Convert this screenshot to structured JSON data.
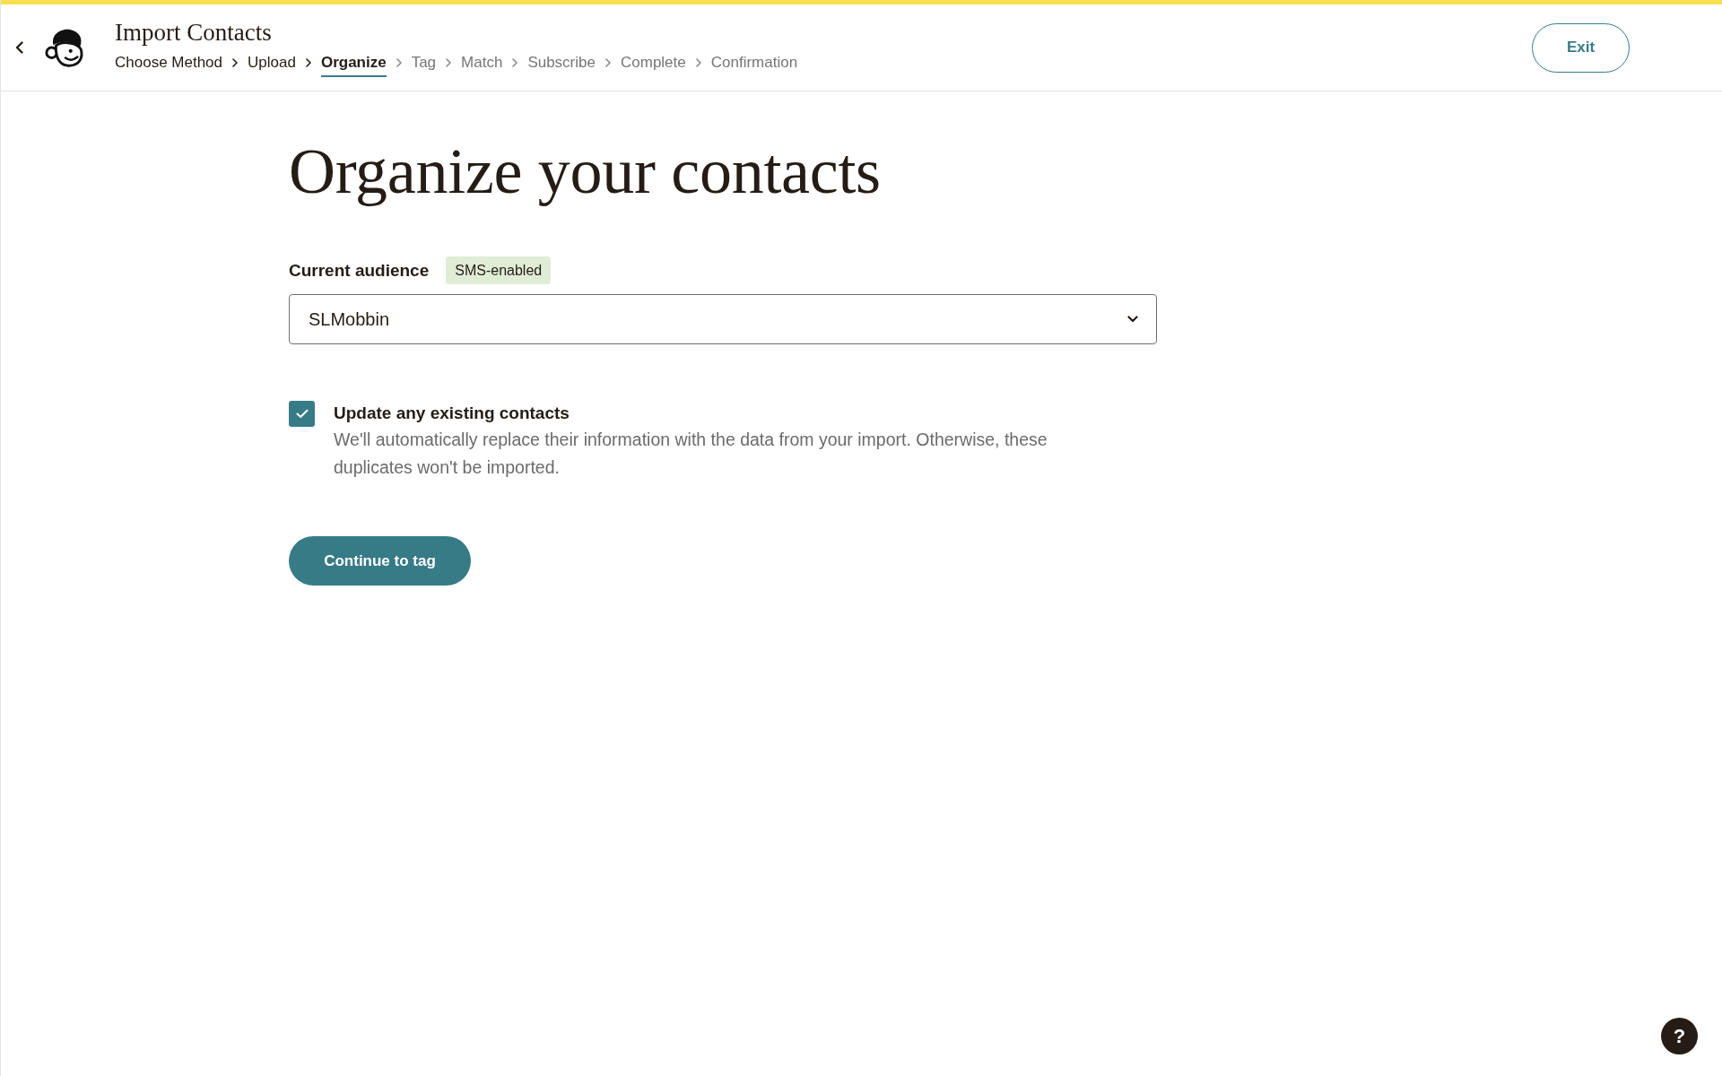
{
  "header": {
    "title": "Import Contacts",
    "steps": [
      {
        "label": "Choose Method",
        "selected": false,
        "completed": true
      },
      {
        "label": "Upload",
        "selected": false,
        "completed": true
      },
      {
        "label": "Organize",
        "selected": true,
        "completed": false
      },
      {
        "label": "Tag",
        "selected": false,
        "completed": false
      },
      {
        "label": "Match",
        "selected": false,
        "completed": false
      },
      {
        "label": "Subscribe",
        "selected": false,
        "completed": false
      },
      {
        "label": "Complete",
        "selected": false,
        "completed": false
      },
      {
        "label": "Confirmation",
        "selected": false,
        "completed": false
      }
    ],
    "exit_button": "Exit"
  },
  "page": {
    "heading": "Organize your contacts",
    "audience": {
      "label": "Current audience",
      "badge": "SMS-enabled",
      "value": "SLMobbin"
    },
    "update_contacts": {
      "label": "Update any existing contacts",
      "description": "We'll automatically replace their information with the data from your import. Otherwise, these duplicates won't be imported.",
      "checked": true
    },
    "continue_button": "Continue to tag"
  },
  "help_button": {
    "label": "?"
  }
}
